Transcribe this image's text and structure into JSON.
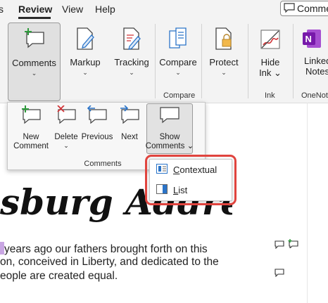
{
  "tabs": [
    {
      "label": "s"
    },
    {
      "label": "Review"
    },
    {
      "label": "View"
    },
    {
      "label": "Help"
    }
  ],
  "top_comments_button": {
    "label": "Comme"
  },
  "ribbon": {
    "comments": {
      "label": "Comments"
    },
    "markup": {
      "label": "Markup"
    },
    "tracking": {
      "label": "Tracking"
    },
    "compare": {
      "label": "Compare"
    },
    "protect": {
      "label": "Protect"
    },
    "hide_ink": {
      "line1": "Hide",
      "line2": "Ink"
    },
    "linked_notes": {
      "line1": "Linked",
      "line2": "Notes"
    },
    "groups": {
      "compare": "Compare",
      "ink": "Ink",
      "onenote": "OneNote"
    }
  },
  "comments_panel": {
    "new_comment": {
      "line1": "New",
      "line2": "Comment"
    },
    "delete": {
      "label": "Delete"
    },
    "previous": {
      "label": "Previous"
    },
    "next": {
      "label": "Next"
    },
    "show_comments": {
      "line1": "Show",
      "line2": "Comments"
    },
    "group_label": "Comments"
  },
  "show_comments_menu": {
    "items": [
      {
        "label_underline": "C",
        "label_rest": "ontextual"
      },
      {
        "label_underline": "L",
        "label_rest": "ist"
      }
    ]
  },
  "document": {
    "title_fragment": "sburg Address",
    "lines": [
      "years ago our fathers brought forth on this",
      "on, conceived in Liberty, and dedicated to the",
      "eople are created equal."
    ]
  },
  "colors": {
    "accent_red": "#e0443e",
    "highlight_purple": "#c9a6e3",
    "onenote_purple": "#7719aa",
    "icon_blue": "#2b74c8",
    "icon_green": "#2e9a3c",
    "icon_red": "#d13438"
  }
}
